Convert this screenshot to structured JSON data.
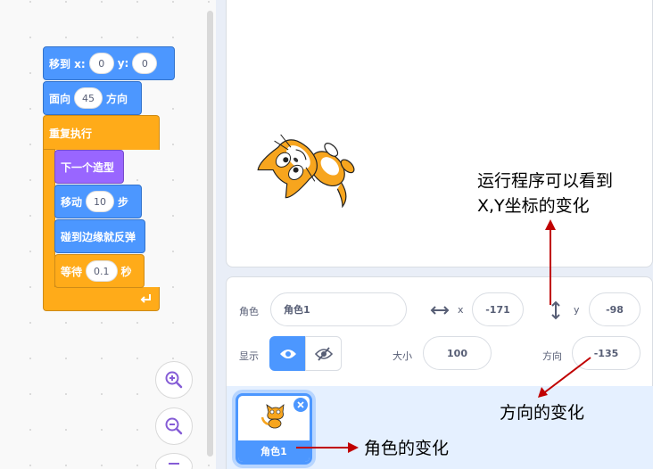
{
  "code": {
    "goto_label": "移到 x:",
    "goto_x": "0",
    "goto_y_label": "y:",
    "goto_y": "0",
    "point_label": "面向",
    "point_value": "45",
    "point_suffix": "方向",
    "forever_label": "重复执行",
    "next_costume_label": "下一个造型",
    "move_label": "移动",
    "move_value": "10",
    "move_suffix": "步",
    "bounce_label": "碰到边缘就反弹",
    "wait_label": "等待",
    "wait_value": "0.1",
    "wait_suffix": "秒"
  },
  "sprite_info": {
    "sprite_label": "角色",
    "sprite_name": "角色1",
    "x_label": "x",
    "x_value": "-171",
    "y_label": "y",
    "y_value": "-98",
    "show_label": "显示",
    "size_label": "大小",
    "size_value": "100",
    "direction_label": "方向",
    "direction_value": "-135"
  },
  "sprite_list": {
    "thumb_name": "角色1"
  },
  "annotations": {
    "xy_line1": "运行程序可以看到",
    "xy_line2": "X,Y坐标的变化",
    "direction_note": "方向的变化",
    "sprite_note": "角色的变化"
  },
  "colors": {
    "motion": "#4c97ff",
    "control": "#ffab19",
    "looks": "#9966ff",
    "arrow": "#c00000",
    "selected": "#855cd6"
  },
  "icons": [
    "zoom-in-icon",
    "zoom-out-icon",
    "reset-zoom-icon",
    "loop-arrow-icon",
    "horizontal-arrows-icon",
    "vertical-arrows-icon",
    "eye-icon",
    "eye-hidden-icon",
    "delete-sprite-icon",
    "cat-sprite-icon"
  ]
}
